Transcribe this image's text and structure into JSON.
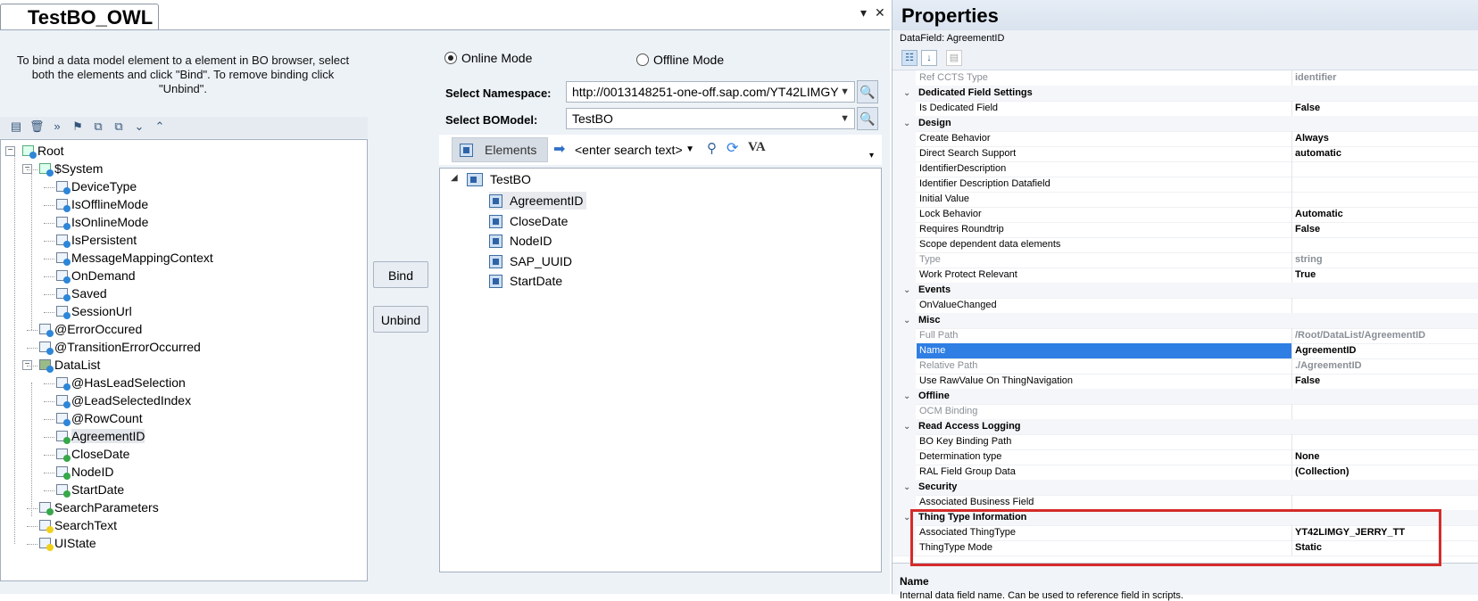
{
  "document": {
    "tab_title": "TestBO_OWL",
    "dropdown_glyph": "▾",
    "close_glyph": "✕"
  },
  "binding_panel": {
    "hint": "To bind a data model element to a element in BO browser, select both the elements and click \"Bind\". To remove binding click \"Unbind\".",
    "toolbar_icons": [
      "new-icon",
      "delete-icon",
      "forward-icon",
      "filter-icon",
      "tree-icon",
      "tree-alt-icon",
      "expand-all-icon",
      "collapse-all-icon"
    ],
    "tree": [
      {
        "label": "Root"
      },
      {
        "label": "$System"
      },
      {
        "label": "DeviceType"
      },
      {
        "label": "IsOfflineMode"
      },
      {
        "label": "IsOnlineMode"
      },
      {
        "label": "IsPersistent"
      },
      {
        "label": "MessageMappingContext"
      },
      {
        "label": "OnDemand"
      },
      {
        "label": "Saved"
      },
      {
        "label": "SessionUrl"
      },
      {
        "label": "@ErrorOccured"
      },
      {
        "label": "@TransitionErrorOccurred"
      },
      {
        "label": "DataList"
      },
      {
        "label": "@HasLeadSelection"
      },
      {
        "label": "@LeadSelectedIndex"
      },
      {
        "label": "@RowCount"
      },
      {
        "label": "AgreementID"
      },
      {
        "label": "CloseDate"
      },
      {
        "label": "NodeID"
      },
      {
        "label": "StartDate"
      },
      {
        "label": "SearchParameters"
      },
      {
        "label": "SearchText"
      },
      {
        "label": "UIState"
      }
    ],
    "bind_label": "Bind",
    "unbind_label": "Unbind"
  },
  "bo_browser": {
    "online_mode": "Online Mode",
    "offline_mode": "Offline Mode",
    "mode_selected": "Online Mode",
    "namespace_label": "Select Namespace:",
    "namespace_value": "http://0013148251-one-off.sap.com/YT42LIMGY",
    "bomodel_label": "Select BOModel:",
    "bomodel_value": "TestBO",
    "elements_label": "Elements",
    "search_placeholder": "<enter search text>",
    "va_label": "VA",
    "root": "TestBO",
    "elements": [
      "AgreementID",
      "CloseDate",
      "NodeID",
      "SAP_UUID",
      "StartDate"
    ],
    "selected_element": "AgreementID"
  },
  "properties": {
    "title": "Properties",
    "subtitle": "DataField: AgreementID",
    "rows": [
      {
        "type": "prop",
        "name": "Ref CCTS Type",
        "value": "identifier",
        "dim": true
      },
      {
        "type": "cat",
        "name": "Dedicated Field Settings"
      },
      {
        "type": "prop",
        "name": "Is Dedicated Field",
        "value": "False"
      },
      {
        "type": "cat",
        "name": "Design"
      },
      {
        "type": "prop",
        "name": "Create Behavior",
        "value": "Always"
      },
      {
        "type": "prop",
        "name": "Direct Search Support",
        "value": "automatic"
      },
      {
        "type": "prop",
        "name": "IdentifierDescription",
        "value": ""
      },
      {
        "type": "prop",
        "name": "Identifier Description Datafield",
        "value": ""
      },
      {
        "type": "prop",
        "name": "Initial Value",
        "value": ""
      },
      {
        "type": "prop",
        "name": "Lock Behavior",
        "value": "Automatic"
      },
      {
        "type": "prop",
        "name": "Requires Roundtrip",
        "value": "False"
      },
      {
        "type": "prop",
        "name": "Scope dependent data elements",
        "value": ""
      },
      {
        "type": "prop",
        "name": "Type",
        "value": "string",
        "dim": true
      },
      {
        "type": "prop",
        "name": "Work Protect Relevant",
        "value": "True"
      },
      {
        "type": "cat",
        "name": "Events"
      },
      {
        "type": "prop",
        "name": "OnValueChanged",
        "value": ""
      },
      {
        "type": "cat",
        "name": "Misc"
      },
      {
        "type": "prop",
        "name": "Full Path",
        "value": "/Root/DataList/AgreementID",
        "dim": true
      },
      {
        "type": "prop",
        "name": "Name",
        "value": "AgreementID",
        "selected": true
      },
      {
        "type": "prop",
        "name": "Relative Path",
        "value": "./AgreementID",
        "dim": true
      },
      {
        "type": "prop",
        "name": "Use RawValue On ThingNavigation",
        "value": "False"
      },
      {
        "type": "cat",
        "name": "Offline"
      },
      {
        "type": "prop",
        "name": "OCM Binding",
        "value": "",
        "dim": true
      },
      {
        "type": "cat",
        "name": "Read Access Logging"
      },
      {
        "type": "prop",
        "name": "BO Key Binding Path",
        "value": ""
      },
      {
        "type": "prop",
        "name": "Determination type",
        "value": "None"
      },
      {
        "type": "prop",
        "name": "RAL Field Group Data",
        "value": "(Collection)"
      },
      {
        "type": "cat",
        "name": "Security"
      },
      {
        "type": "prop",
        "name": "Associated Business Field",
        "value": ""
      },
      {
        "type": "cat",
        "name": "Thing Type Information"
      },
      {
        "type": "prop",
        "name": "Associated ThingType",
        "value": "YT42LIMGY_JERRY_TT"
      },
      {
        "type": "prop",
        "name": "ThingType Mode",
        "value": "Static"
      }
    ],
    "description_title": "Name",
    "description_text": "Internal data field name. Can be used to reference field in scripts."
  },
  "colors": {
    "selection": "#2f7ee3",
    "highlight_box": "#d42b2b"
  }
}
